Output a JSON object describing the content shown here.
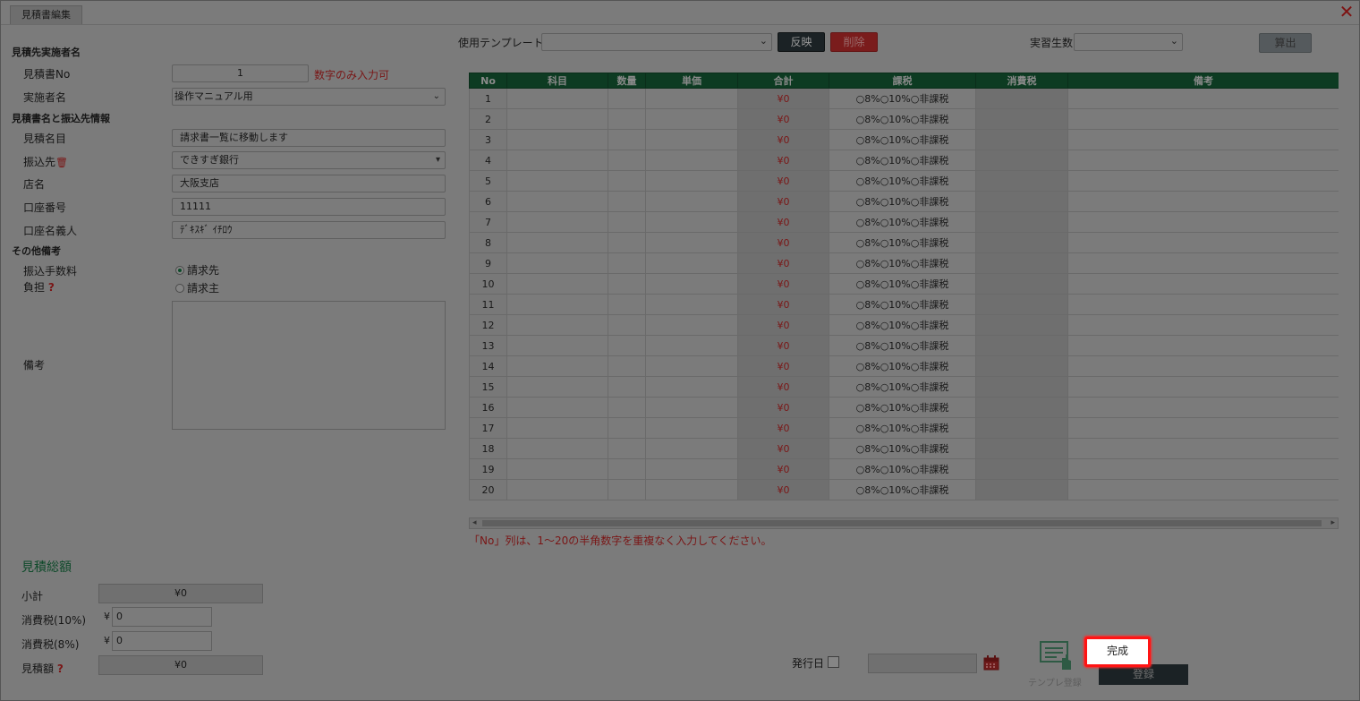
{
  "window": {
    "title": "見積書編集",
    "close_icon": "close-icon"
  },
  "left": {
    "sec1": "見積先実施者名",
    "no_label": "見積書No",
    "no_value": "1",
    "no_hint": "数字のみ入力可",
    "impl_label": "実施者名",
    "impl_value": "操作マニュアル用",
    "sec2": "見積書名と振込先情報",
    "name_label": "見積名目",
    "name_value": "請求書一覧に移動します",
    "bank_label": "振込先",
    "bank_value": "できすぎ銀行",
    "branch_label": "店名",
    "branch_value": "大阪支店",
    "account_label": "口座番号",
    "account_value": "11111",
    "holder_label": "口座名義人",
    "holder_value": "ﾃﾞｷｽｷﾞ ｲﾁﾛｳ",
    "sec3": "その他備考",
    "fee_label_1": "振込手数料",
    "fee_label_2": "負担",
    "fee_opt1": "請求先",
    "fee_opt2": "請求主",
    "notes_label": "備考"
  },
  "top": {
    "template_label": "使用テンプレート",
    "apply": "反映",
    "delete": "削除",
    "trainees_label": "実習生数",
    "calc": "算出"
  },
  "table": {
    "headers": [
      "No",
      "科目",
      "数量",
      "単価",
      "合計",
      "課税",
      "消費税",
      "備考"
    ],
    "rows": [
      "1",
      "2",
      "3",
      "4",
      "5",
      "6",
      "7",
      "8",
      "9",
      "10",
      "11",
      "12",
      "13",
      "14",
      "15",
      "16",
      "17",
      "18",
      "19",
      "20"
    ],
    "sum_value": "¥0",
    "tax_options": "○8%○10%○非課税",
    "note": "「No」列は、1～20の半角数字を重複なく入力してください。"
  },
  "summary": {
    "title": "見積総額",
    "subtotal_label": "小計",
    "subtotal_value": "¥0",
    "tax10_label": "消費税(10%)",
    "tax10_value": "0",
    "tax8_label": "消費税(8%)",
    "tax8_value": "0",
    "yen": "¥",
    "total_label": "見積額",
    "total_value": "¥0"
  },
  "footer": {
    "issue_label": "発行日",
    "template_register": "テンプレ登録",
    "register": "登録",
    "complete": "完成"
  },
  "colors": {
    "header_green": "#0d3b22",
    "accent_red": "#7a1616",
    "highlight": "#ff1414"
  }
}
